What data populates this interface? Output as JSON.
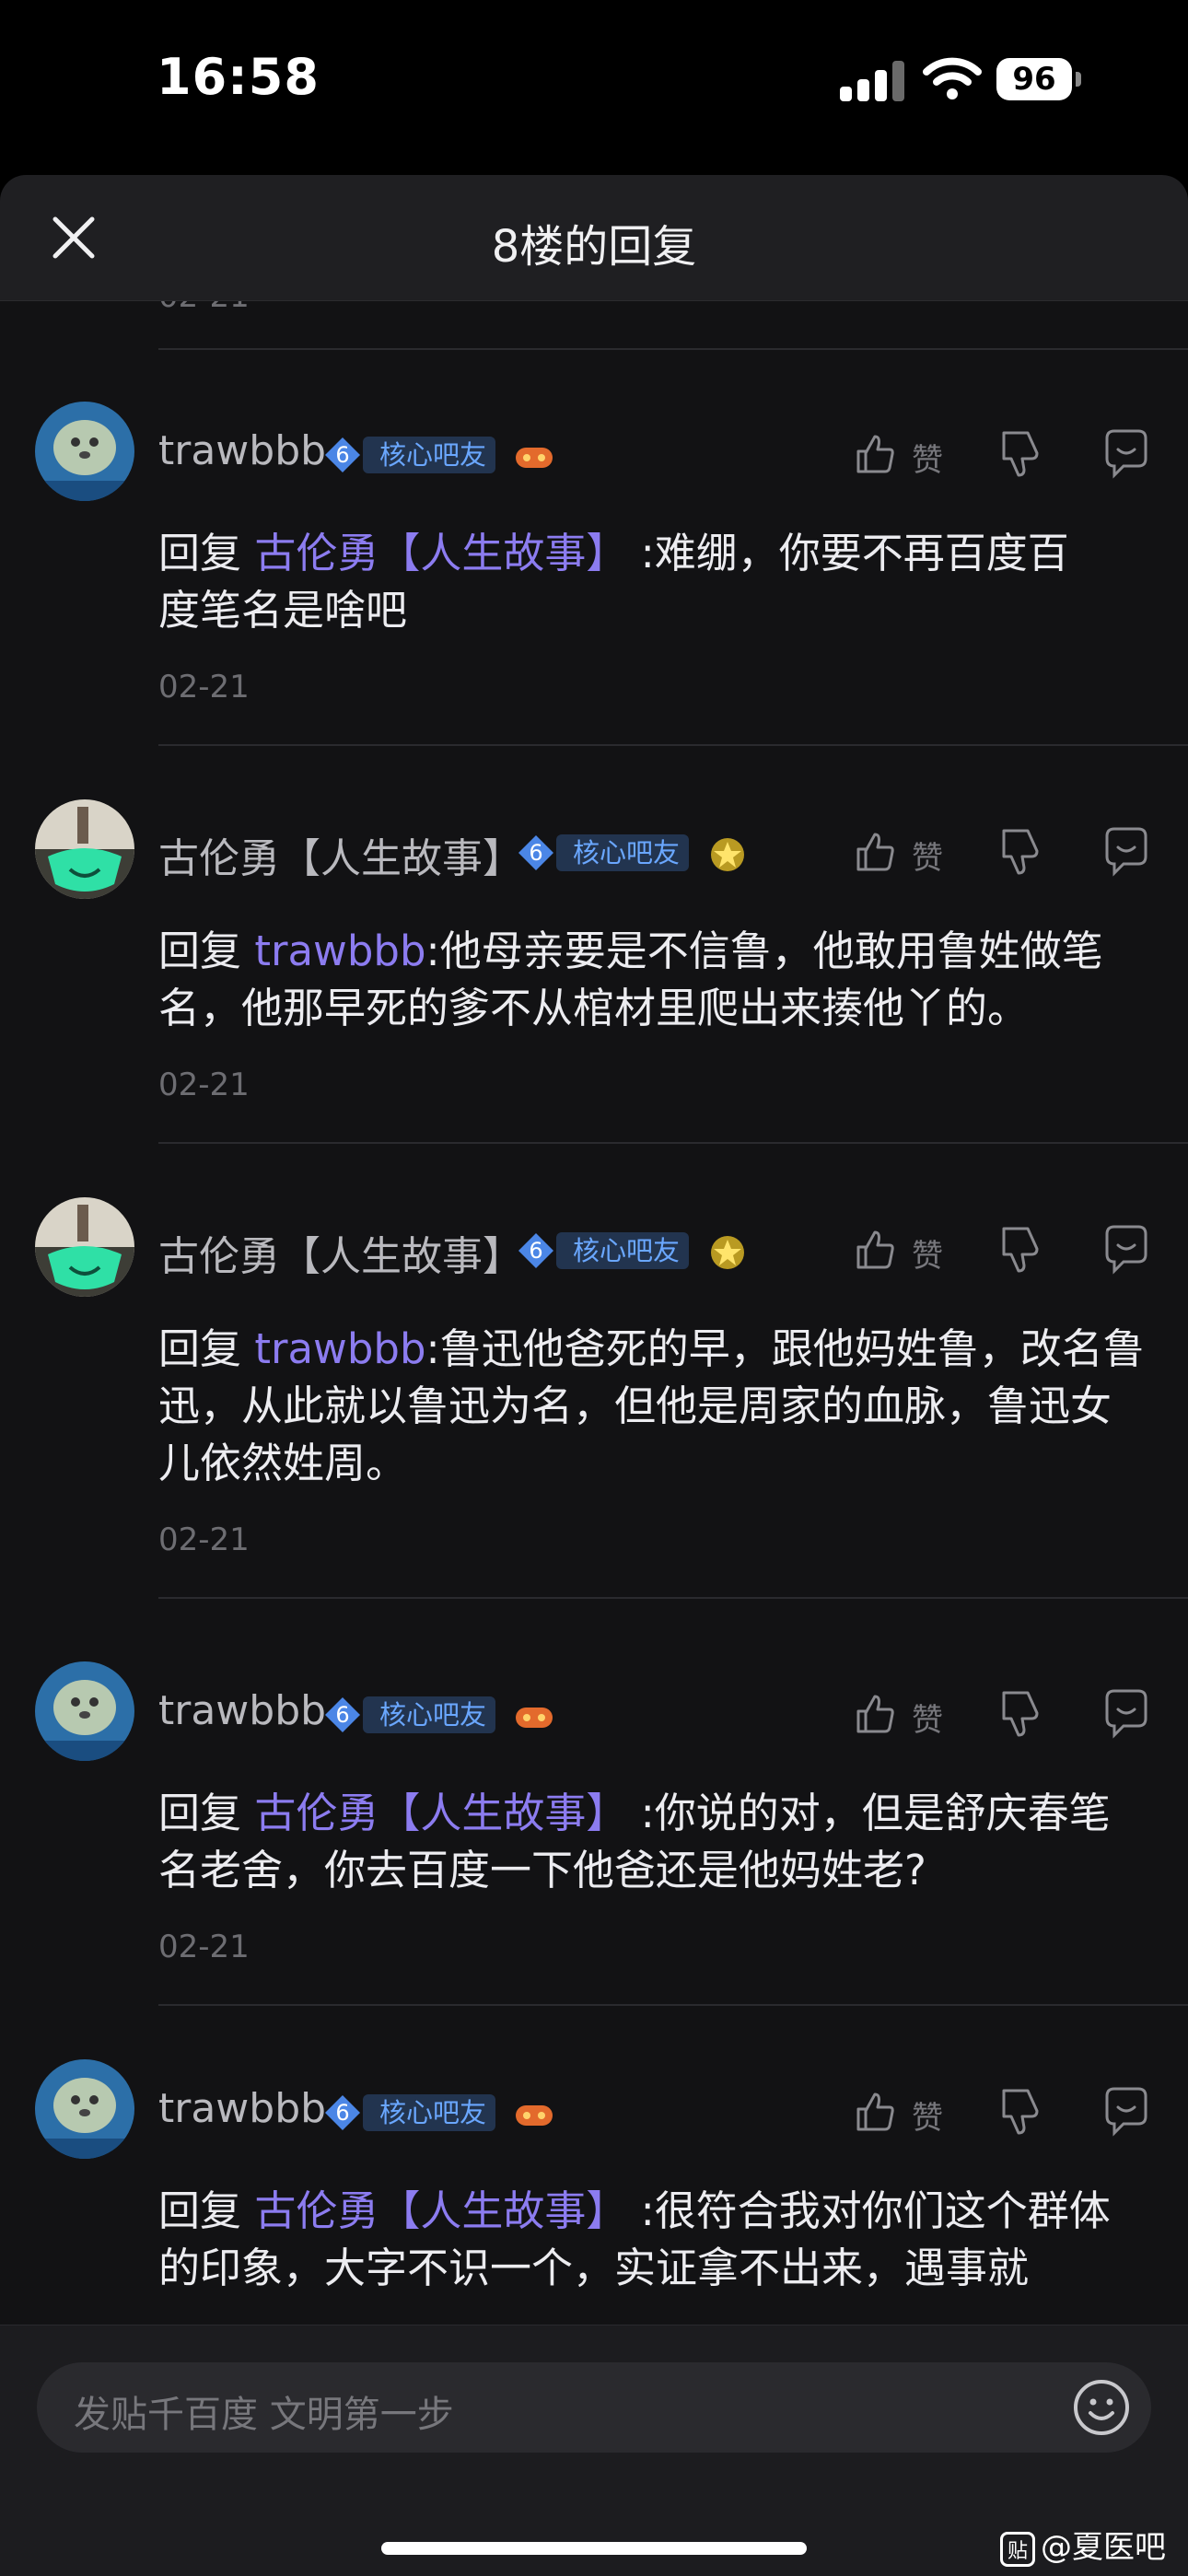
{
  "status_bar": {
    "time": "16:58",
    "battery": "96"
  },
  "header": {
    "title": "8楼的回复"
  },
  "previous_date": "02-21",
  "comments": [
    {
      "username": "trawbbb",
      "level": "6",
      "badge": "核心吧友",
      "medal_icon": "game-controller-icon",
      "reply_prefix": "回复",
      "mention": "古伦勇【人生故事】",
      "text_before_break": " :难绷，你要不再百度百",
      "text_after_break": "度笔名是啥吧",
      "date": "02-21",
      "like_label": "赞"
    },
    {
      "username": "古伦勇【人生故事】",
      "level": "6",
      "badge": "核心吧友",
      "medal_icon": "gold-star-medal-icon",
      "reply_prefix": "回复",
      "mention": "trawbbb",
      "text": ":他母亲要是不信鲁，他敢用鲁姓做笔名，他那早死的爹不从棺材里爬出来揍他丫的。",
      "date": "02-21",
      "like_label": "赞"
    },
    {
      "username": "古伦勇【人生故事】",
      "level": "6",
      "badge": "核心吧友",
      "medal_icon": "gold-star-medal-icon",
      "reply_prefix": "回复",
      "mention": "trawbbb",
      "text": ":鲁迅他爸死的早，跟他妈姓鲁，改名鲁迅，从此就以鲁迅为名，但他是周家的血脉，鲁迅女儿依然姓周。",
      "date": "02-21",
      "like_label": "赞"
    },
    {
      "username": "trawbbb",
      "level": "6",
      "badge": "核心吧友",
      "medal_icon": "game-controller-icon",
      "reply_prefix": "回复",
      "mention": "古伦勇【人生故事】",
      "text": " :你说的对，但是舒庆春笔名老舍，你去百度一下他爸还是他妈姓老?",
      "date": "02-21",
      "like_label": "赞"
    },
    {
      "username": "trawbbb",
      "level": "6",
      "badge": "核心吧友",
      "medal_icon": "game-controller-icon",
      "reply_prefix": "回复",
      "mention": "古伦勇【人生故事】",
      "text": " :很符合我对你们这个群体的印象，大字不识一个，实证拿不出来，遇事就",
      "date": "",
      "like_label": "赞"
    }
  ],
  "input": {
    "placeholder": "发贴千百度 文明第一步"
  },
  "watermark": {
    "logo_char": "贴",
    "text": "@夏医吧"
  },
  "colors": {
    "accent_mention": "#8c7cf0",
    "badge_text": "#6aa7ff",
    "background": "#121214"
  }
}
